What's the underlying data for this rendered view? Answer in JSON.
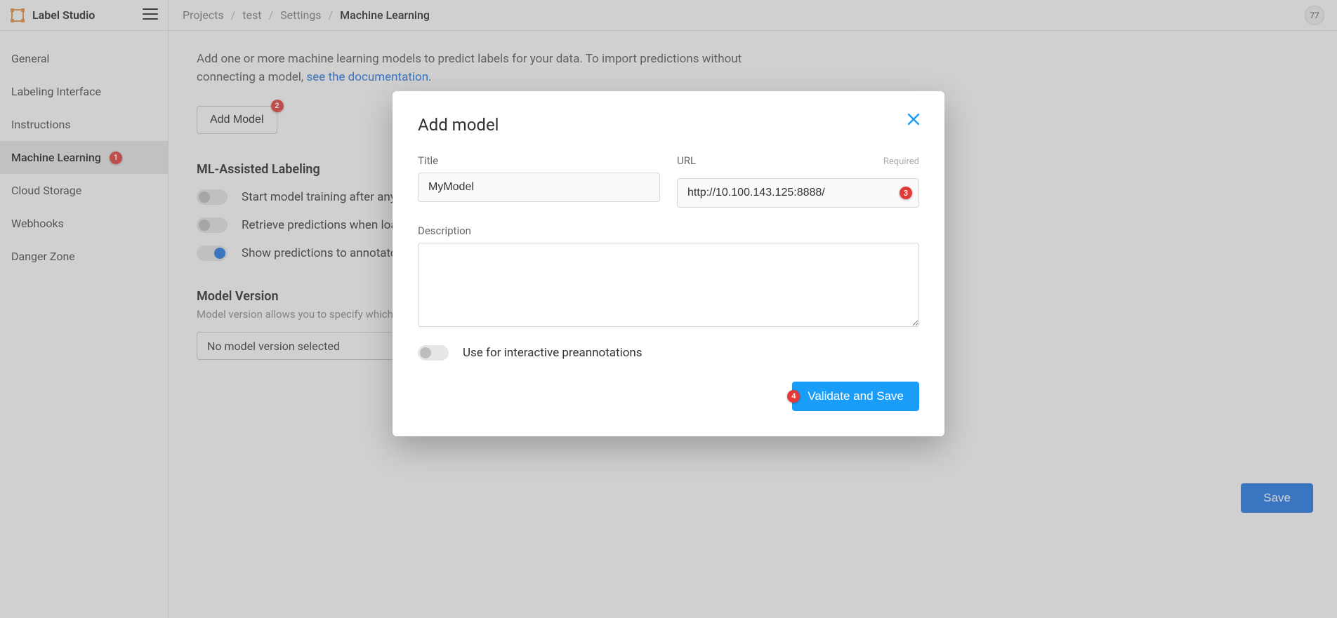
{
  "brand": {
    "name": "Label Studio"
  },
  "topbar": {
    "count": "77",
    "breadcrumbs": [
      {
        "label": "Projects"
      },
      {
        "label": "test"
      },
      {
        "label": "Settings"
      },
      {
        "label": "Machine Learning"
      }
    ]
  },
  "sidebar": {
    "items": [
      {
        "label": "General",
        "active": false
      },
      {
        "label": "Labeling Interface",
        "active": false
      },
      {
        "label": "Instructions",
        "active": false
      },
      {
        "label": "Machine Learning",
        "active": true,
        "badge": "1"
      },
      {
        "label": "Cloud Storage",
        "active": false
      },
      {
        "label": "Webhooks",
        "active": false
      },
      {
        "label": "Danger Zone",
        "active": false
      }
    ]
  },
  "main": {
    "intro_prefix": "Add one or more machine learning models to predict labels for your data. To import predictions without connecting a model, ",
    "intro_link": "see the documentation",
    "intro_suffix": ".",
    "add_model_btn": "Add Model",
    "add_model_badge": "2",
    "ml_assisted_heading": "ML-Assisted Labeling",
    "toggles": [
      {
        "on": false,
        "label": "Start model training after any annotations are submitted or updated"
      },
      {
        "on": false,
        "label": "Retrieve predictions when loading a task automatically"
      },
      {
        "on": true,
        "label": "Show predictions to annotators in the Label Stream and Quick View"
      }
    ],
    "model_version_heading": "Model Version",
    "model_version_sub": "Model version allows you to specify which prediction will be shown to annotators.",
    "model_version_select": "No model version selected",
    "save_btn": "Save"
  },
  "modal": {
    "title": "Add model",
    "title_label": "Title",
    "title_value": "MyModel",
    "url_label": "URL",
    "url_required": "Required",
    "url_value": "http://10.100.143.125:8888/",
    "url_badge": "3",
    "desc_label": "Description",
    "desc_value": "",
    "interactive_toggle_label": "Use for interactive preannotations",
    "interactive_toggle_on": false,
    "submit_btn": "Validate and Save",
    "submit_badge": "4"
  }
}
